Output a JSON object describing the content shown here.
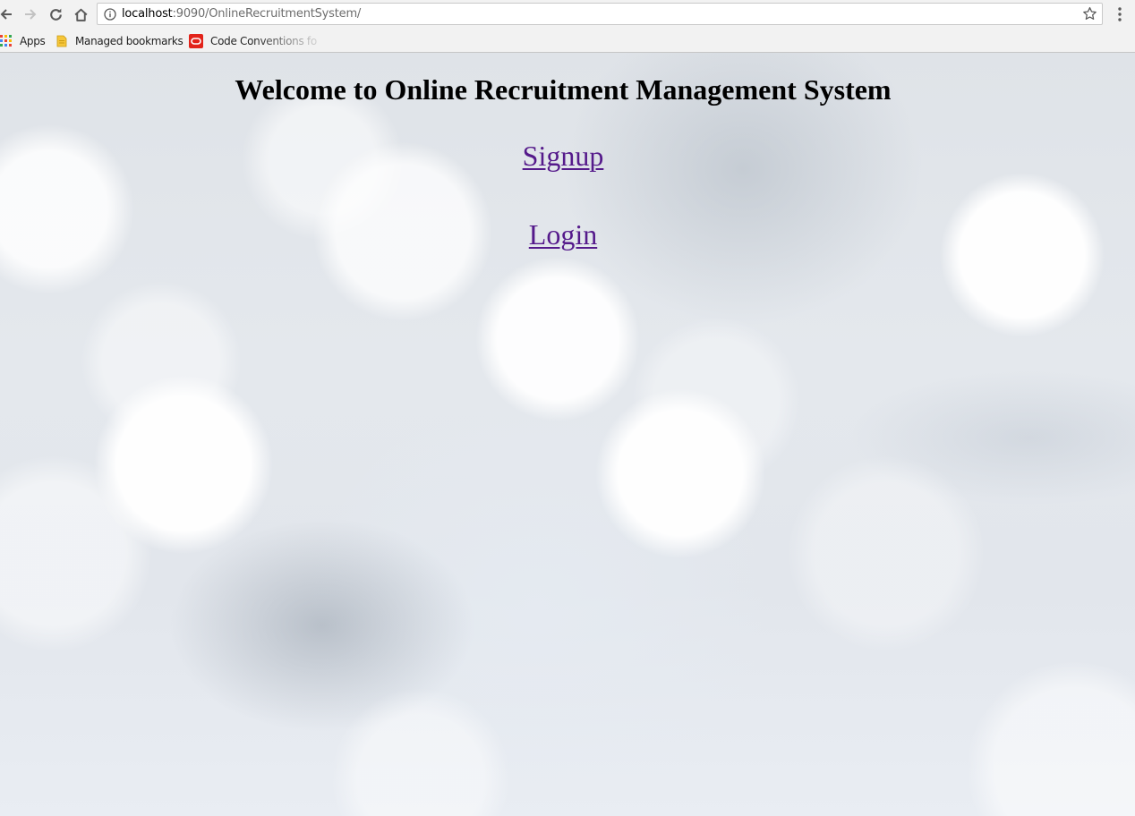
{
  "browser": {
    "url_host": "localhost",
    "url_rest": ":9090/OnlineRecruitmentSystem/",
    "icons": {
      "back": "arrow-left-icon",
      "forward": "arrow-right-icon",
      "reload": "reload-icon",
      "home": "home-icon",
      "info": "info-circle-icon",
      "star": "star-icon",
      "menu": "vertical-dots-icon"
    }
  },
  "bookmarks": {
    "items": [
      {
        "label": "Apps",
        "icon": "apps-grid-icon"
      },
      {
        "label": "Managed bookmarks",
        "icon": "folder-icon"
      },
      {
        "label": "Code Conventions fo",
        "icon": "oracle-logo-icon"
      }
    ]
  },
  "page": {
    "heading": "Welcome to Online Recruitment Management System",
    "links": [
      {
        "label": "Signup"
      },
      {
        "label": "Login"
      }
    ],
    "link_color": "#551a8b"
  }
}
